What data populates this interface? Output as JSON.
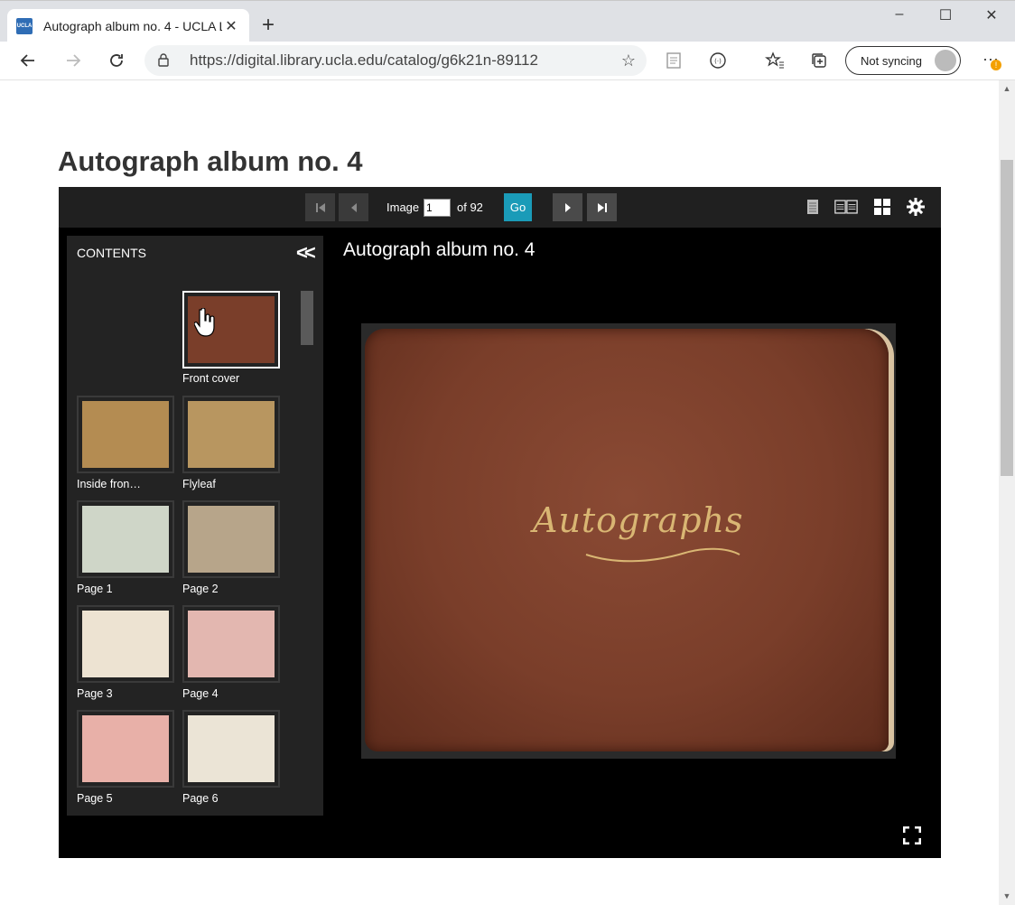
{
  "browser": {
    "tab_title": "Autograph album no. 4 - UCLA L",
    "favicon_text": "UCLA",
    "url": "https://digital.library.ucla.edu/catalog/g6k21n-89112",
    "profile_label": "Not syncing",
    "notification_badge": "!"
  },
  "page": {
    "title": "Autograph album no. 4"
  },
  "viewer": {
    "image_label": "Image",
    "current_image": "1",
    "of_total": "of 92",
    "go_label": "Go",
    "contents_label": "CONTENTS",
    "canvas_title": "Autograph album no. 4",
    "cover_text": "Autographs",
    "thumbnails": [
      {
        "label": "Front cover",
        "color": "#7a3e2a",
        "active": true
      },
      {
        "label": "Inside fron…",
        "color": "#b48c52"
      },
      {
        "label": "Flyleaf",
        "color": "#b89660"
      },
      {
        "label": "Page 1",
        "color": "#cfd6c8"
      },
      {
        "label": "Page 2",
        "color": "#b7a58a"
      },
      {
        "label": "Page 3",
        "color": "#ede3d2"
      },
      {
        "label": "Page 4",
        "color": "#e3b7b0"
      },
      {
        "label": "Page 5",
        "color": "#e8b0a8"
      },
      {
        "label": "Page 6",
        "color": "#ebe4d6"
      }
    ]
  },
  "colors": {
    "go_button": "#1a9bb8",
    "viewer_bg": "#000000",
    "panel_bg": "#232323",
    "cover_leather": "#7a3e2a",
    "cover_gold": "#d9b673"
  }
}
